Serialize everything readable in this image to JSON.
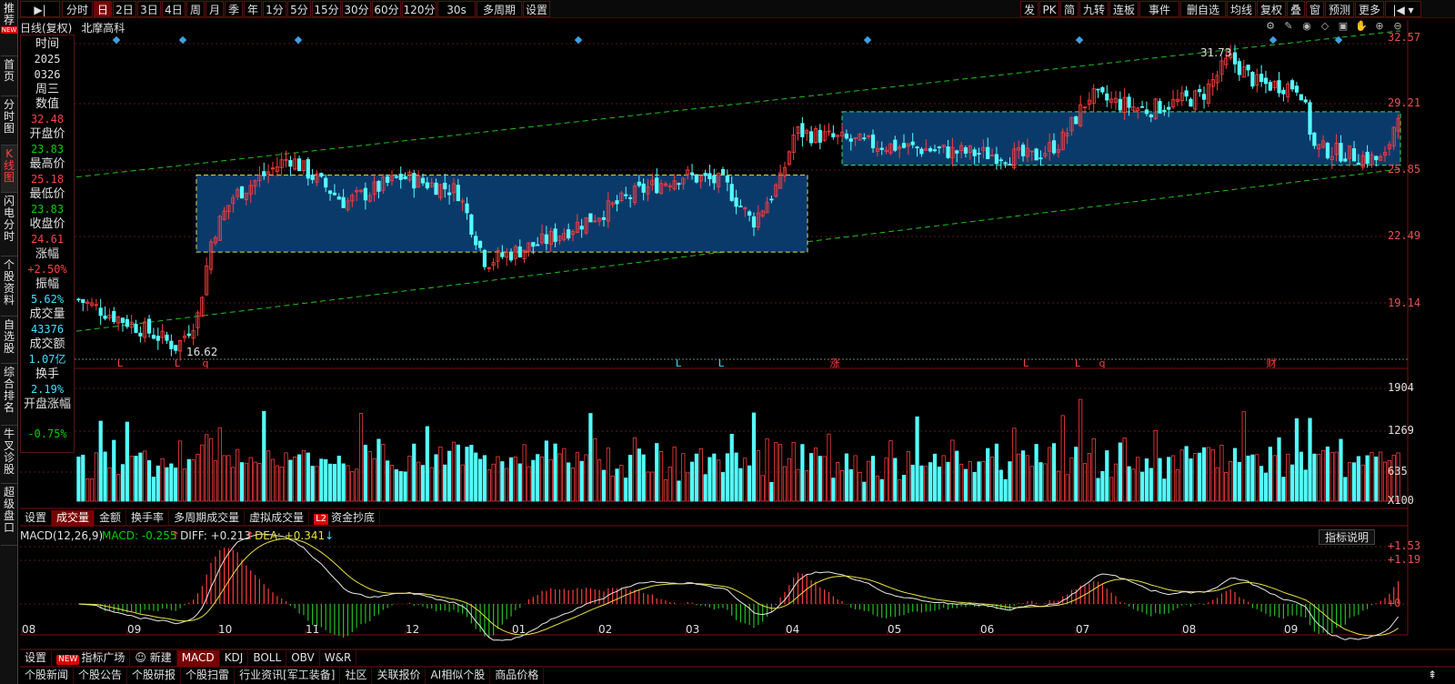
{
  "sidebar": [
    {
      "label": "推荐",
      "badge": "NEW"
    },
    {
      "label": "首页"
    },
    {
      "label": "分时图"
    },
    {
      "label": "K线图",
      "active": true
    },
    {
      "label": "闪电分时"
    },
    {
      "label": "个股资料"
    },
    {
      "label": "自选股"
    },
    {
      "label": "综合排名"
    },
    {
      "label": "牛叉诊股"
    },
    {
      "label": "超级盘口"
    }
  ],
  "toolbar_left": [
    "分时",
    "日",
    "2日",
    "3日",
    "4日",
    "周",
    "月",
    "季",
    "年",
    "1分",
    "5分",
    "15分",
    "30分",
    "60分",
    "120分",
    "30s",
    "多周期",
    "设置"
  ],
  "toolbar_active": "日",
  "toolbar_right": [
    "发",
    "PK",
    "简",
    "九转",
    "连板",
    "事件",
    "删自选",
    "均线",
    "复权",
    "叠",
    "窗",
    "预测",
    "更多"
  ],
  "chart_header": {
    "mode": "日线(复权)",
    "stock": "北摩高科"
  },
  "data_panel": {
    "rows": [
      {
        "label": "时间",
        "value": "2025",
        "value2": "0326",
        "color": "#e0e0e0"
      },
      {
        "label": "周三"
      },
      {
        "label": "数值",
        "value": "32.48",
        "color": "#ff4040"
      },
      {
        "label": "开盘价",
        "value": "23.83",
        "color": "#00d000"
      },
      {
        "label": "最高价",
        "value": "25.18",
        "color": "#ff4040"
      },
      {
        "label": "最低价",
        "value": "23.83",
        "color": "#00d000"
      },
      {
        "label": "收盘价",
        "value": "24.61",
        "color": "#ff4040"
      },
      {
        "label": "涨幅",
        "value": "+2.50%",
        "color": "#ff4040"
      },
      {
        "label": "振幅",
        "value": "5.62%",
        "color": "#40e0ff"
      },
      {
        "label": "成交量",
        "value": "43376",
        "color": "#40e0ff"
      },
      {
        "label": "成交额",
        "value": "1.07亿",
        "color": "#40e0ff"
      },
      {
        "label": "换手",
        "value": "2.19%",
        "color": "#40e0ff"
      },
      {
        "label": "开盘涨幅",
        "value": "-0.75%",
        "color": "#00d000"
      }
    ]
  },
  "price_axis": [
    "32.57",
    "29.21",
    "25.85",
    "22.49",
    "19.14"
  ],
  "price_annotations": {
    "high": "31.73",
    "low": "16.62"
  },
  "event_markers": [
    "L",
    "L",
    "q",
    "L",
    "L",
    "涨",
    "L",
    "L",
    "q",
    "财"
  ],
  "volume_axis": [
    "1904",
    "1269",
    "635",
    "X100"
  ],
  "volume_tabs": [
    "设置",
    "成交量",
    "金额",
    "换手率",
    "多周期成交量",
    "虚拟成交量",
    "资金抄底"
  ],
  "volume_tab_active": "成交量",
  "l2_badge": "L2",
  "macd": {
    "title": "MACD(12,26,9)",
    "macd_label": "MACD: -0.255",
    "diff_label": "DIFF: +0.213",
    "dea_label": "DEA: +0.341",
    "axis": [
      "+1.53",
      "+1.19",
      "+0"
    ],
    "explain": "指标说明"
  },
  "months": [
    "08",
    "09",
    "10",
    "11",
    "12",
    "01",
    "02",
    "03",
    "04",
    "05",
    "06",
    "07",
    "08",
    "09"
  ],
  "indicator_tabs": [
    "设置",
    "指标广场",
    "新建",
    "MACD",
    "KDJ",
    "BOLL",
    "OBV",
    "W&R"
  ],
  "indicator_active": "MACD",
  "new_badge": "NEW",
  "bottom_tabs": [
    "个股新闻",
    "个股公告",
    "个股研报",
    "个股扫雷",
    "行业资讯[军工装备]",
    "社区",
    "关联报价",
    "AI相似个股",
    "商品价格"
  ],
  "colors": {
    "up": "#ff3c3c",
    "down": "#54ffff",
    "box": "#0a3a6a",
    "channel": "#20c020",
    "ma_white": "#e8e8e8",
    "ma_yellow": "#e8e040"
  }
}
